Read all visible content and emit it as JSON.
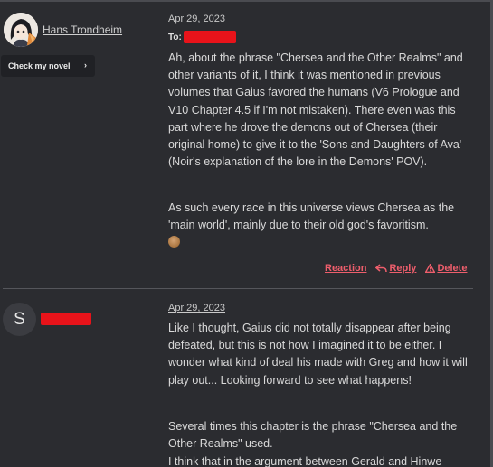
{
  "comments": [
    {
      "author": "Hans Trondheim",
      "novel_button": "Check my novel",
      "date": "Apr 29, 2023",
      "to_label": "To:",
      "paragraphs": [
        "Ah, about the phrase \"Chersea and the Other Realms\" and other variants of it, I think it was mentioned in previous volumes that Gaius favored the humans (V6 Prologue and V10 Chapter 4.5 if I'm not mistaken). There even was this part where he drove the demons out of Chersea (their original home) to give it to the 'Sons and Daughters of Ava' (Noir's explanation of the lore in the Demons' POV).",
        "As such every race in this universe views Chersea as the 'main world', mainly due to their old god's favoritism."
      ],
      "actions": {
        "reaction": "Reaction",
        "reply": "Reply",
        "delete": "Delete"
      }
    },
    {
      "avatar_letter": "S",
      "date": "Apr 29, 2023",
      "paragraphs": [
        "Like I thought, Gaius did not totally disappear after being defeated, but this is not how I imagined it to be either. I wonder what kind of deal his made with Greg and how it will play out... Looking forward to see what happens!",
        "Several times this chapter is the phrase \"Chersea and the Other Realms\" used.",
        "I think that in the argument between Gerald and Hinwe"
      ]
    }
  ],
  "colors": {
    "background": "#2b2c30",
    "action": "#ee5e6c",
    "redaction": "#e8131a"
  }
}
